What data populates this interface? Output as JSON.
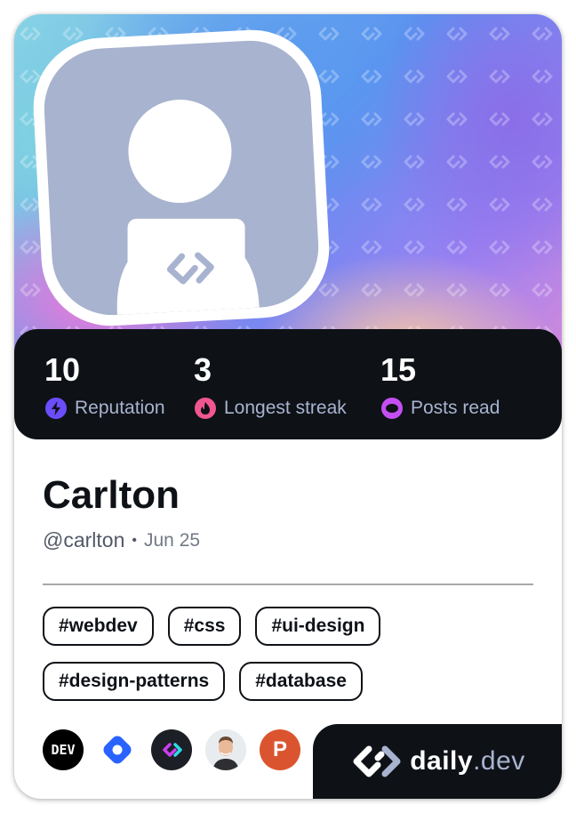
{
  "profile": {
    "name": "Carlton",
    "handle": "@carlton",
    "separator": "•",
    "joined": "Jun 25"
  },
  "stats": [
    {
      "value": "10",
      "label": "Reputation",
      "icon": "lightning-icon",
      "color": "#6b4dfa"
    },
    {
      "value": "3",
      "label": "Longest streak",
      "icon": "flame-icon",
      "color": "#f0568f"
    },
    {
      "value": "15",
      "label": "Posts read",
      "icon": "eye-icon",
      "color": "#c54ef2"
    }
  ],
  "tags": [
    "#webdev",
    "#css",
    "#ui-design",
    "#design-patterns",
    "#database"
  ],
  "links": [
    {
      "icon": "dev-to-icon",
      "text": "DEV"
    },
    {
      "icon": "hashnode-icon"
    },
    {
      "icon": "daily-dev-icon"
    },
    {
      "icon": "user-photo-avatar"
    },
    {
      "icon": "product-hunt-icon",
      "text": "P"
    }
  ],
  "brand": {
    "name": "daily",
    "suffix": ".dev"
  },
  "colors": {
    "background": "#0e1217",
    "avatar_placeholder": "#a8b3cf",
    "label": "#a8b3cf"
  }
}
